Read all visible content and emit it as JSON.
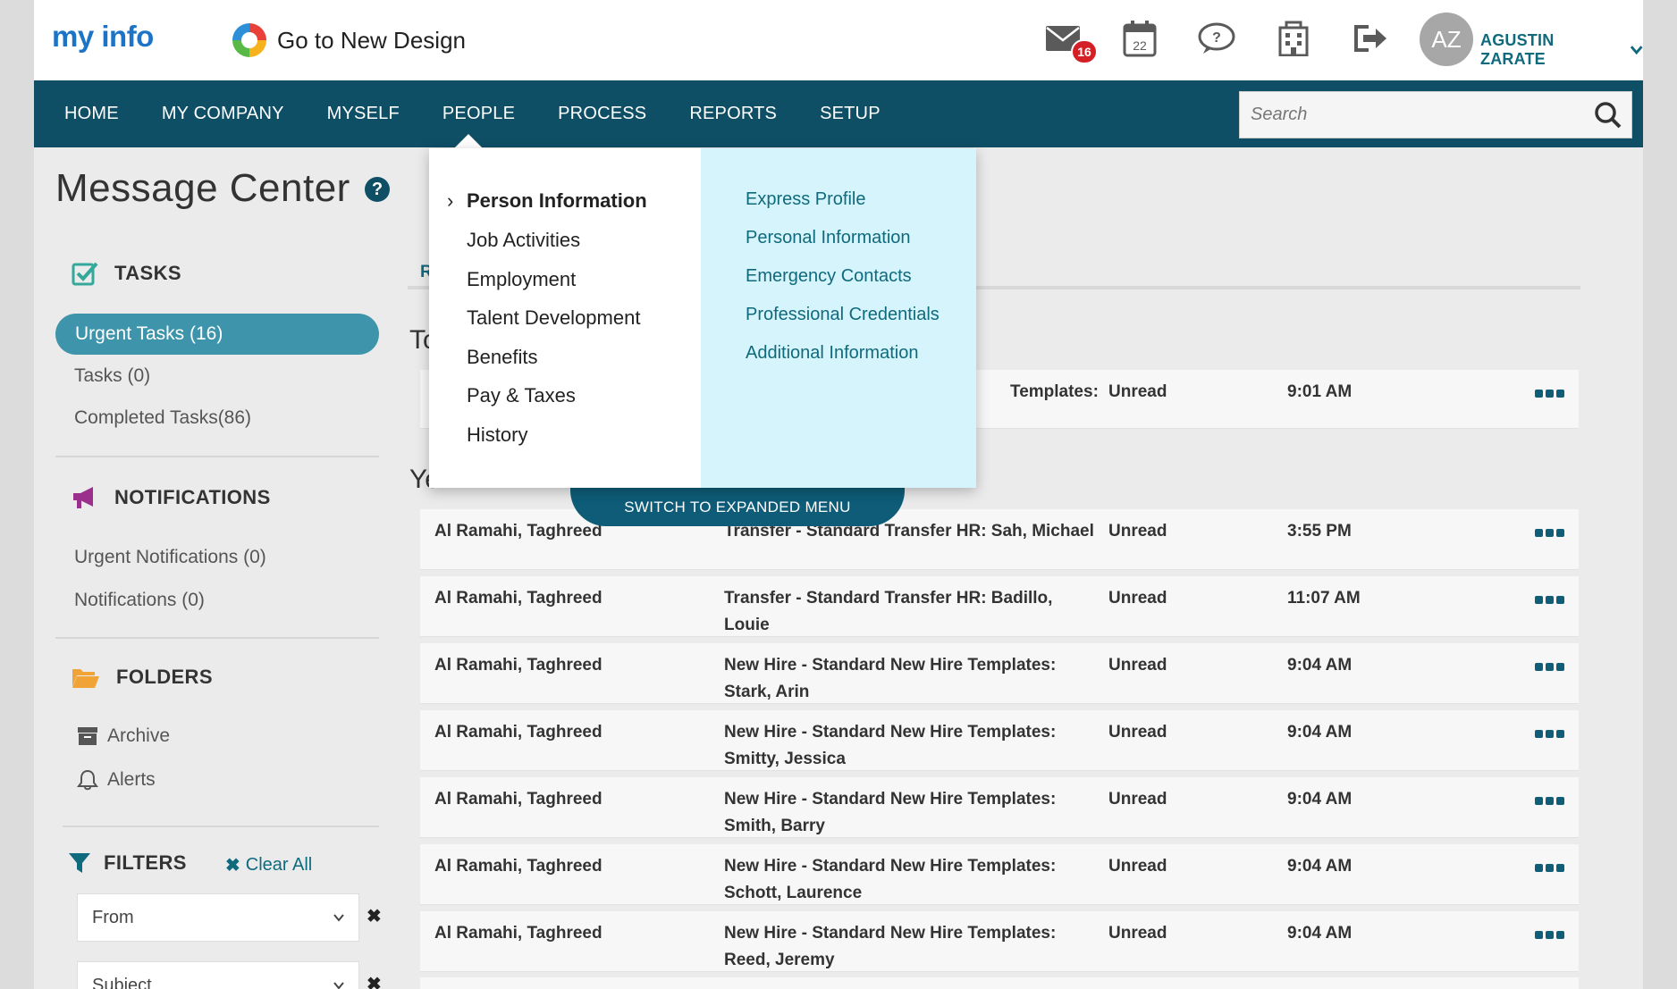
{
  "app": {
    "logo_text": "myinfo",
    "new_design_label": "Go to New Design",
    "mail_count": "16",
    "calendar_day": "22",
    "user_initials": "AZ",
    "user_name": "AGUSTIN ZARATE",
    "accent_color": "#0e4f66",
    "icons": [
      "mail-icon",
      "calendar-icon",
      "chat-icon",
      "building-icon",
      "logout-icon",
      "chevron-down-icon"
    ]
  },
  "nav": {
    "items": [
      "HOME",
      "MY COMPANY",
      "MYSELF",
      "PEOPLE",
      "PROCESS",
      "REPORTS",
      "SETUP"
    ],
    "search_placeholder": "Search"
  },
  "page": {
    "title": "Message Center",
    "help": "?"
  },
  "sidebar": {
    "tasks_heading": "TASKS",
    "tasks": [
      "Urgent Tasks (16)",
      "Tasks (0)",
      "Completed Tasks(86)"
    ],
    "notifications_heading": "NOTIFICATIONS",
    "notifications": [
      "Urgent Notifications (0)",
      "Notifications (0)"
    ],
    "folders_heading": "FOLDERS",
    "folders": [
      "Archive",
      "Alerts"
    ],
    "filters_heading": "FILTERS",
    "clear_all": "Clear All",
    "filter_selects": [
      "From",
      "Subject"
    ]
  },
  "dropdown": {
    "menu_items": [
      "Person Information",
      "Job Activities",
      "Employment",
      "Talent Development",
      "Benefits",
      "Pay & Taxes",
      "History"
    ],
    "sub_items": [
      "Express Profile",
      "Personal Information",
      "Emergency Contacts",
      "Professional Credentials",
      "Additional Information"
    ],
    "switch_label": "SWITCH TO EXPANDED MENU"
  },
  "main": {
    "tab_stub": "R",
    "today_label": "To",
    "yesterday_label": "Ye",
    "today_rows": [
      {
        "subject": "Templates:",
        "status": "Unread",
        "time": "9:01 AM"
      }
    ],
    "yesterday_rows": [
      {
        "from": "Al Ramahi, Taghreed",
        "subject": "Transfer - Standard Transfer HR: Sah, Michael",
        "status": "Unread",
        "time": "3:55 PM"
      },
      {
        "from": "Al Ramahi, Taghreed",
        "subject": "Transfer - Standard Transfer HR: Badillo, Louie",
        "status": "Unread",
        "time": "11:07 AM"
      },
      {
        "from": "Al Ramahi, Taghreed",
        "subject": "New Hire - Standard New Hire Templates: Stark, Arin",
        "status": "Unread",
        "time": "9:04 AM"
      },
      {
        "from": "Al Ramahi, Taghreed",
        "subject": "New Hire - Standard New Hire Templates: Smitty, Jessica",
        "status": "Unread",
        "time": "9:04 AM"
      },
      {
        "from": "Al Ramahi, Taghreed",
        "subject": "New Hire - Standard New Hire Templates: Smith, Barry",
        "status": "Unread",
        "time": "9:04 AM"
      },
      {
        "from": "Al Ramahi, Taghreed",
        "subject": "New Hire - Standard New Hire Templates: Schott, Laurence",
        "status": "Unread",
        "time": "9:04 AM"
      },
      {
        "from": "Al Ramahi, Taghreed",
        "subject": "New Hire - Standard New Hire Templates: Reed, Jeremy",
        "status": "Unread",
        "time": "9:04 AM"
      }
    ]
  }
}
